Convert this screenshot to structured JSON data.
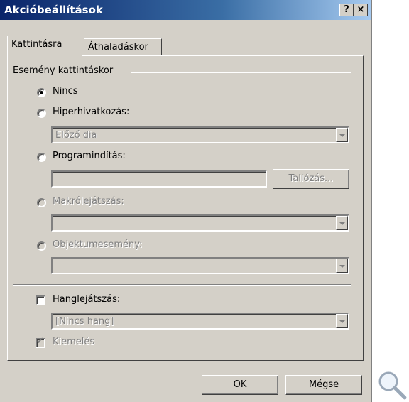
{
  "title": "Akcióbeállítások",
  "title_buttons": {
    "help": "?",
    "close": "×"
  },
  "tabs": [
    "Kattintásra",
    "Áthaladáskor"
  ],
  "group_label": "Esemény kattintáskor",
  "options": {
    "none": "Nincs",
    "hyperlink": "Hiperhivatkozás:",
    "hyperlink_value": "Előző dia",
    "run_program": "Programindítás:",
    "browse": "Tallózás...",
    "run_macro": "Makrólejátszás:",
    "object_action": "Objektumesemény:"
  },
  "sound": {
    "label": "Hanglejátszás:",
    "value": "[Nincs hang]",
    "highlight": "Kiemelés"
  },
  "buttons": {
    "ok": "OK",
    "cancel": "Mégse"
  },
  "icons": {
    "magnifier": "magnifier-icon"
  },
  "colors": {
    "title_start": "#0a246a",
    "face": "#d4d0c8"
  }
}
